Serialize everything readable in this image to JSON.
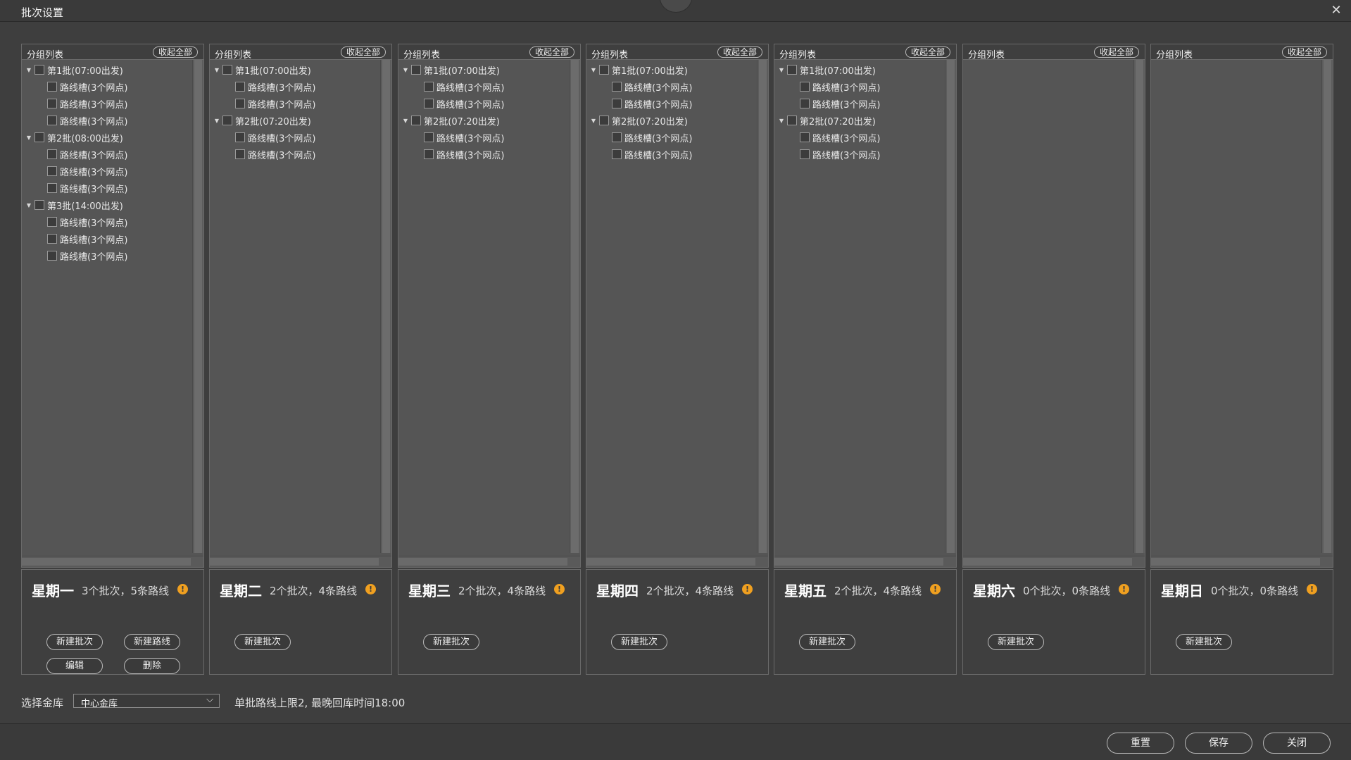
{
  "window": {
    "title": "批次设置",
    "close_icon": "close-icon"
  },
  "group_list_label": "分组列表",
  "collapse_all_label": "收起全部",
  "columns": [
    {
      "day": "星期一",
      "summary": "3个批次，5条路线",
      "batches": [
        {
          "label": "第1批(07:00出发)",
          "routes": [
            "路线槽(3个网点)",
            "路线槽(3个网点)",
            "路线槽(3个网点)"
          ]
        },
        {
          "label": "第2批(08:00出发)",
          "routes": [
            "路线槽(3个网点)",
            "路线槽(3个网点)",
            "路线槽(3个网点)"
          ]
        },
        {
          "label": "第3批(14:00出发)",
          "routes": [
            "路线槽(3个网点)",
            "路线槽(3个网点)",
            "路线槽(3个网点)"
          ]
        }
      ],
      "buttons": [
        "新建批次",
        "新建路线",
        "编辑",
        "删除"
      ]
    },
    {
      "day": "星期二",
      "summary": "2个批次，4条路线",
      "batches": [
        {
          "label": "第1批(07:00出发)",
          "routes": [
            "路线槽(3个网点)",
            "路线槽(3个网点)"
          ]
        },
        {
          "label": "第2批(07:20出发)",
          "routes": [
            "路线槽(3个网点)",
            "路线槽(3个网点)"
          ]
        }
      ],
      "buttons": [
        "新建批次"
      ]
    },
    {
      "day": "星期三",
      "summary": "2个批次，4条路线",
      "batches": [
        {
          "label": "第1批(07:00出发)",
          "routes": [
            "路线槽(3个网点)",
            "路线槽(3个网点)"
          ]
        },
        {
          "label": "第2批(07:20出发)",
          "routes": [
            "路线槽(3个网点)",
            "路线槽(3个网点)"
          ]
        }
      ],
      "buttons": [
        "新建批次"
      ]
    },
    {
      "day": "星期四",
      "summary": "2个批次，4条路线",
      "batches": [
        {
          "label": "第1批(07:00出发)",
          "routes": [
            "路线槽(3个网点)",
            "路线槽(3个网点)"
          ]
        },
        {
          "label": "第2批(07:20出发)",
          "routes": [
            "路线槽(3个网点)",
            "路线槽(3个网点)"
          ]
        }
      ],
      "buttons": [
        "新建批次"
      ]
    },
    {
      "day": "星期五",
      "summary": "2个批次，4条路线",
      "batches": [
        {
          "label": "第1批(07:00出发)",
          "routes": [
            "路线槽(3个网点)",
            "路线槽(3个网点)"
          ]
        },
        {
          "label": "第2批(07:20出发)",
          "routes": [
            "路线槽(3个网点)",
            "路线槽(3个网点)"
          ]
        }
      ],
      "buttons": [
        "新建批次"
      ]
    },
    {
      "day": "星期六",
      "summary": "0个批次，0条路线",
      "batches": [],
      "buttons": [
        "新建批次"
      ]
    },
    {
      "day": "星期日",
      "summary": "0个批次，0条路线",
      "batches": [],
      "buttons": [
        "新建批次"
      ]
    }
  ],
  "bottom": {
    "vault_label": "选择金库",
    "vault_value": "中心金库",
    "note": "单批路线上限2, 最晚回库时间18:00"
  },
  "footer": {
    "reset_label": "重置",
    "save_label": "保存",
    "close_label": "关闭"
  },
  "colors": {
    "info_badge": "#f0a020",
    "background": "#3e3e3e",
    "panel": "#555555"
  }
}
